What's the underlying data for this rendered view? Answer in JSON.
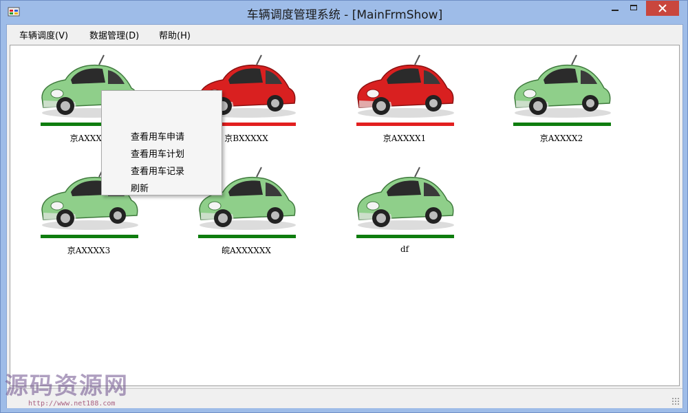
{
  "window": {
    "title": "车辆调度管理系统 - [MainFrmShow]"
  },
  "menu": [
    {
      "label": "车辆调度(V)"
    },
    {
      "label": "数据管理(D)"
    },
    {
      "label": "帮助(H)"
    }
  ],
  "vehicles": [
    {
      "plate": "京AXXXX",
      "status_color": "green"
    },
    {
      "plate": "京BXXXXX",
      "status_color": "red"
    },
    {
      "plate": "京AXXXX1",
      "status_color": "red"
    },
    {
      "plate": "京AXXXX2",
      "status_color": "green"
    },
    {
      "plate": "京AXXXX3",
      "status_color": "green"
    },
    {
      "plate": "皖AXXXXXX",
      "status_color": "green"
    },
    {
      "plate": "df",
      "status_color": "green"
    }
  ],
  "context_menu": [
    {
      "label": "查看用车申请"
    },
    {
      "label": "查看用车计划"
    },
    {
      "label": "查看用车记录"
    },
    {
      "label": "刷新"
    }
  ],
  "watermark": {
    "text": "源码资源网",
    "url": "http://www.net188.com"
  },
  "colors": {
    "available": "#0e7d0e",
    "in_use": "#e21f1f",
    "car_green": "#8fcf8a",
    "car_red": "#d92020"
  }
}
